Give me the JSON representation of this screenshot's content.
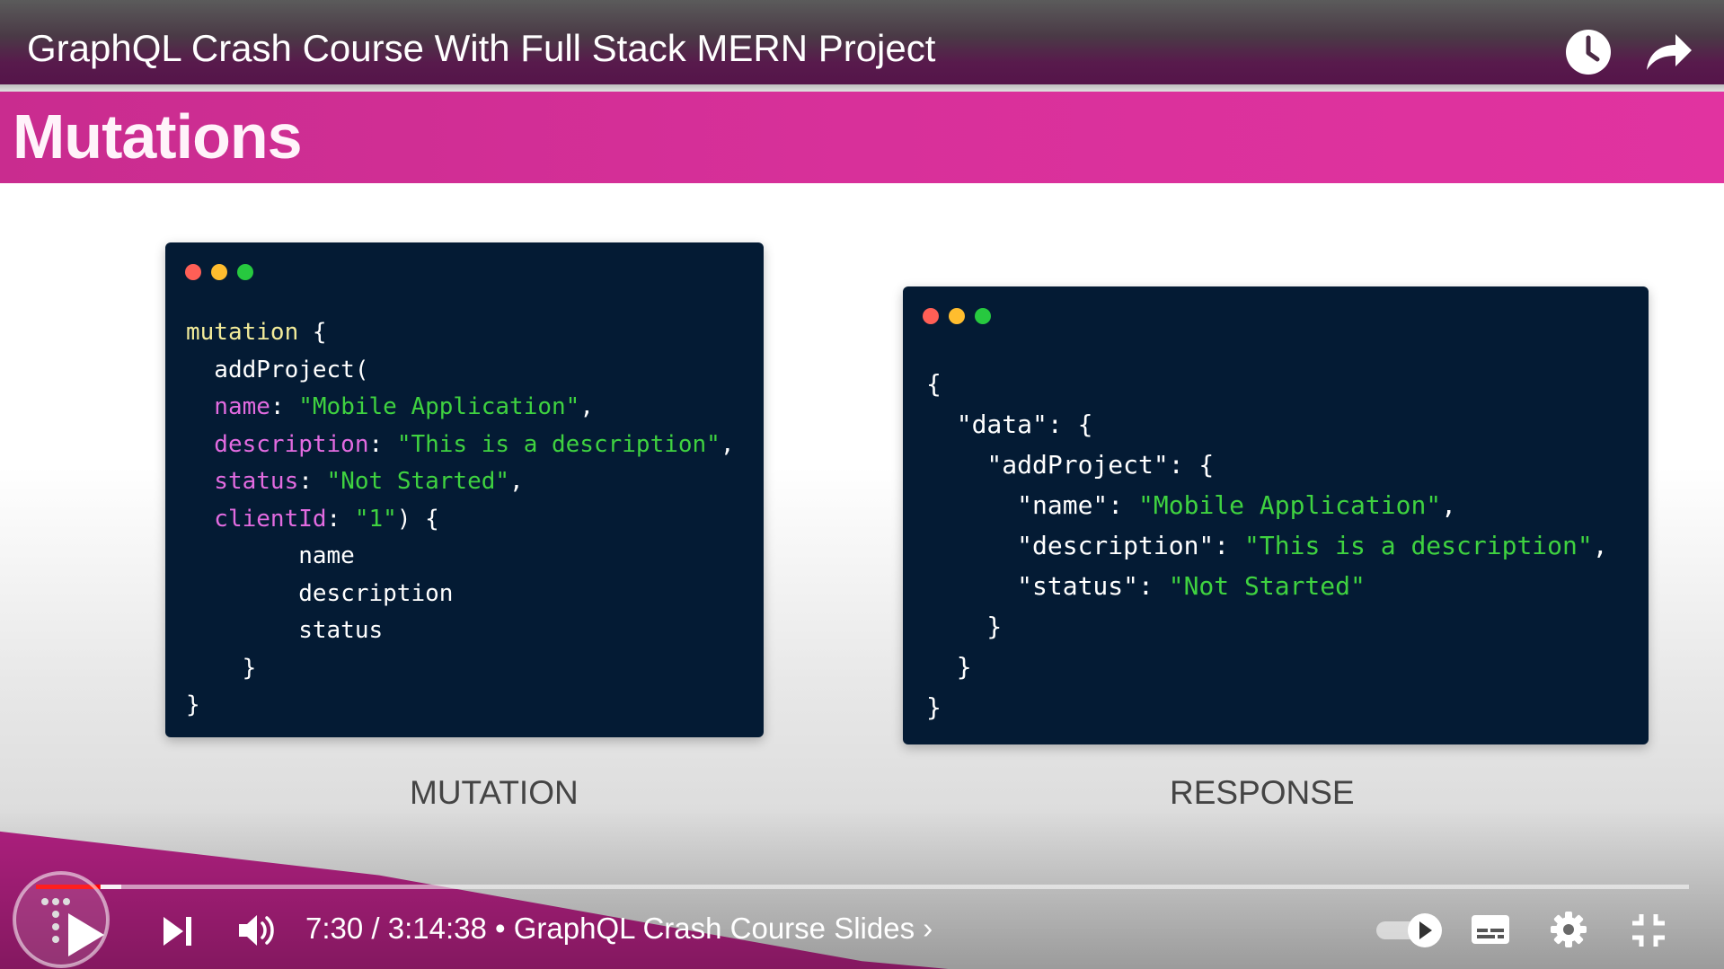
{
  "video": {
    "title": "GraphQL Crash Course With Full Stack MERN Project",
    "current_time": "7:30",
    "separator": " / ",
    "duration": "3:14:38",
    "chapter_prefix": "•",
    "chapter": "GraphQL Crash Course Slides",
    "chapter_chevron": "›",
    "progress_fraction": 0.039
  },
  "slide": {
    "title": "Mutations",
    "left_caption": "MUTATION",
    "right_caption": "RESPONSE",
    "mutation_lines": [
      [
        {
          "t": "kw",
          "v": "mutation"
        },
        {
          "t": "plain",
          "v": " {"
        }
      ],
      [
        {
          "t": "plain",
          "v": "  addProject("
        }
      ],
      [
        {
          "t": "key",
          "v": "  name"
        },
        {
          "t": "plain",
          "v": ": "
        },
        {
          "t": "str",
          "v": "\"Mobile Application\""
        },
        {
          "t": "plain",
          "v": ","
        }
      ],
      [
        {
          "t": "key",
          "v": "  description"
        },
        {
          "t": "plain",
          "v": ": "
        },
        {
          "t": "str",
          "v": "\"This is a description\""
        },
        {
          "t": "plain",
          "v": ","
        }
      ],
      [
        {
          "t": "key",
          "v": "  status"
        },
        {
          "t": "plain",
          "v": ": "
        },
        {
          "t": "str",
          "v": "\"Not Started\""
        },
        {
          "t": "plain",
          "v": ","
        }
      ],
      [
        {
          "t": "key",
          "v": "  clientId"
        },
        {
          "t": "plain",
          "v": ": "
        },
        {
          "t": "str",
          "v": "\"1\""
        },
        {
          "t": "plain",
          "v": ") {"
        }
      ],
      [
        {
          "t": "plain",
          "v": "        name"
        }
      ],
      [
        {
          "t": "plain",
          "v": "        description"
        }
      ],
      [
        {
          "t": "plain",
          "v": "        status"
        }
      ],
      [
        {
          "t": "plain",
          "v": "    }"
        }
      ],
      [
        {
          "t": "plain",
          "v": "}"
        }
      ]
    ],
    "response_lines": [
      [
        {
          "t": "plain",
          "v": "{"
        }
      ],
      [
        {
          "t": "plain",
          "v": "  \"data\": {"
        }
      ],
      [
        {
          "t": "plain",
          "v": "    \"addProject\": {"
        }
      ],
      [
        {
          "t": "plain",
          "v": "      \"name\": "
        },
        {
          "t": "str",
          "v": "\"Mobile Application\""
        },
        {
          "t": "plain",
          "v": ","
        }
      ],
      [
        {
          "t": "plain",
          "v": "      \"description\": "
        },
        {
          "t": "str",
          "v": "\"This is a description\""
        },
        {
          "t": "plain",
          "v": ","
        }
      ],
      [
        {
          "t": "plain",
          "v": "      \"status\": "
        },
        {
          "t": "str",
          "v": "\"Not Started\""
        }
      ],
      [
        {
          "t": "plain",
          "v": "    }"
        }
      ],
      [
        {
          "t": "plain",
          "v": "  }"
        }
      ],
      [
        {
          "t": "plain",
          "v": "}"
        }
      ]
    ]
  },
  "icons": {
    "watch_later": "clock-icon",
    "share": "share-arrow-icon",
    "channel_logo": "channel-logo-icon",
    "play": "play-icon",
    "next": "skip-next-icon",
    "volume": "volume-icon",
    "autoplay": "autoplay-toggle-icon",
    "captions": "captions-icon",
    "settings": "gear-icon",
    "exit_fullscreen": "exit-fullscreen-icon"
  },
  "colors": {
    "accent_pink": "#d8309a",
    "code_bg": "#041b34",
    "progress_red": "#ff0000",
    "dot_red": "#ff5f56",
    "dot_yellow": "#ffbd2e",
    "dot_green": "#27c93f"
  }
}
